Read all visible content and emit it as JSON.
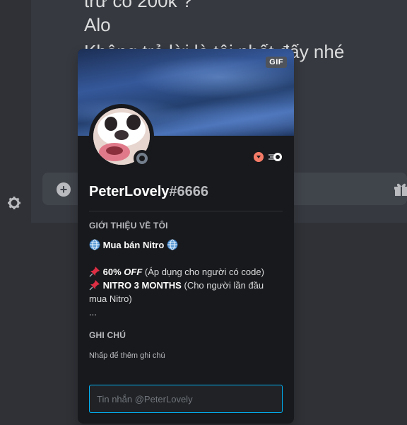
{
  "chat": {
    "messages": [
      "trừ có 200k ?",
      "Alo",
      "Không trả lời là tôi phốt đấy nhé"
    ]
  },
  "profile": {
    "banner_badge": "GIF",
    "username": "PeterLovely",
    "discriminator": "#6666",
    "about_title": "GIỚI THIỆU VỀ TÔI",
    "about_line1": "Mua bán Nitro",
    "about_line2_bold": "60%",
    "about_line2_italic": "OFF",
    "about_line2_rest": "(Áp dụng cho người có code)",
    "about_line3_bold": "NITRO 3 MONTHS",
    "about_line3_rest": "(Cho người lần đầu",
    "about_line4": "mua Nitro)",
    "about_line5": "...",
    "note_title": "GHI CHÚ",
    "note_hint": "Nhấp để thêm ghi chú",
    "message_placeholder": "Tin nhắn @PeterLovely"
  },
  "colors": {
    "background": "#36393f",
    "popout": "#18191c",
    "accent": "#00b0f4",
    "status_offline": "#747f8d"
  },
  "icons": [
    "plus-icon",
    "gift-icon",
    "gear-icon",
    "globe-icon",
    "pushpin-icon",
    "hypesquad-badge-icon",
    "nitro-boost-badge-icon",
    "status-offline-icon"
  ]
}
